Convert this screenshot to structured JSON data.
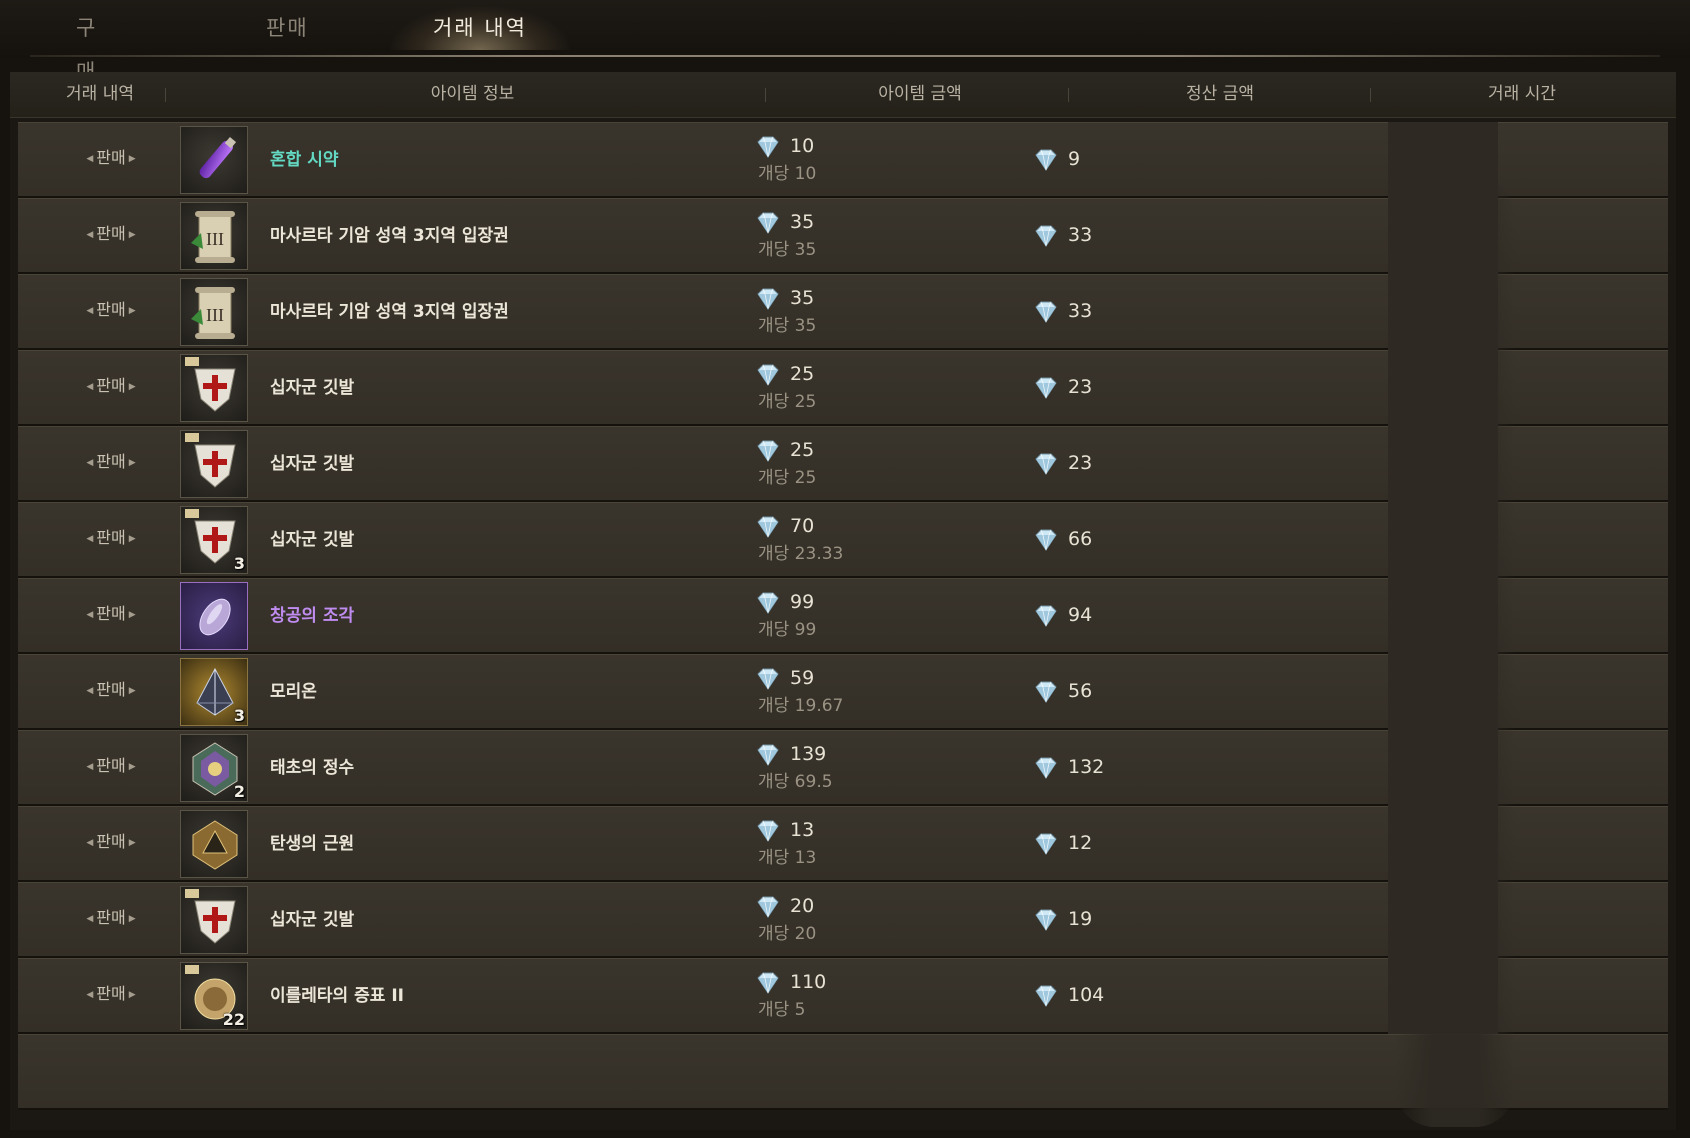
{
  "tabs": [
    {
      "label": "구매",
      "active": false
    },
    {
      "label": "판매",
      "active": false
    },
    {
      "label": "거래 내역",
      "active": true
    }
  ],
  "columns": {
    "history": "거래 내역",
    "item_info": "아이템 정보",
    "item_price": "아이템 금액",
    "settlement": "정산 금액",
    "time": "거래 시간"
  },
  "colors": {
    "accent_green": "#63d9c3",
    "accent_purple": "#c08cf0",
    "row_bg": "#38332a"
  },
  "rows": [
    {
      "type": "판매",
      "icon": "mixed-reagent-icon",
      "name": "혼합 시약",
      "name_color": "green",
      "qty": "",
      "price": "10",
      "unit": "개당 10",
      "settle": "9"
    },
    {
      "type": "판매",
      "icon": "entry-ticket-scroll-icon",
      "name": "마사르타 기암 성역 3지역 입장권",
      "name_color": "white",
      "qty": "",
      "price": "35",
      "unit": "개당 35",
      "settle": "33"
    },
    {
      "type": "판매",
      "icon": "entry-ticket-scroll-icon",
      "name": "마사르타 기암 성역 3지역 입장권",
      "name_color": "white",
      "qty": "",
      "price": "35",
      "unit": "개당 35",
      "settle": "33"
    },
    {
      "type": "판매",
      "icon": "crusader-flag-icon",
      "name": "십자군 깃발",
      "name_color": "white",
      "qty": "",
      "price": "25",
      "unit": "개당 25",
      "settle": "23"
    },
    {
      "type": "판매",
      "icon": "crusader-flag-icon",
      "name": "십자군 깃발",
      "name_color": "white",
      "qty": "",
      "price": "25",
      "unit": "개당 25",
      "settle": "23"
    },
    {
      "type": "판매",
      "icon": "crusader-flag-icon",
      "name": "십자군 깃발",
      "name_color": "white",
      "qty": "3",
      "price": "70",
      "unit": "개당 23.33",
      "settle": "66"
    },
    {
      "type": "판매",
      "icon": "sky-fragment-icon",
      "name": "창공의 조각",
      "name_color": "purple",
      "qty": "",
      "price": "99",
      "unit": "개당 99",
      "settle": "94"
    },
    {
      "type": "판매",
      "icon": "morion-crystal-icon",
      "name": "모리온",
      "name_color": "white",
      "qty": "3",
      "price": "59",
      "unit": "개당 19.67",
      "settle": "56"
    },
    {
      "type": "판매",
      "icon": "primordial-essence-icon",
      "name": "태초의 정수",
      "name_color": "white",
      "qty": "2",
      "price": "139",
      "unit": "개당 69.5",
      "settle": "132"
    },
    {
      "type": "판매",
      "icon": "origin-of-birth-icon",
      "name": "탄생의 근원",
      "name_color": "white",
      "qty": "",
      "price": "13",
      "unit": "개당 13",
      "settle": "12"
    },
    {
      "type": "판매",
      "icon": "crusader-flag-icon",
      "name": "십자군 깃발",
      "name_color": "white",
      "qty": "",
      "price": "20",
      "unit": "개당 20",
      "settle": "19"
    },
    {
      "type": "판매",
      "icon": "irleta-token-icon",
      "name": "이를레타의 증표 II",
      "name_color": "white",
      "qty": "22",
      "price": "110",
      "unit": "개당 5",
      "settle": "104"
    }
  ]
}
